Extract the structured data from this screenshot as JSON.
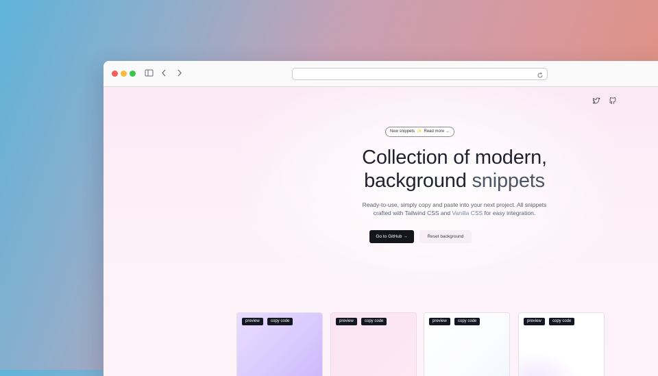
{
  "browser": {
    "url": "",
    "icons": [
      "sidebar-toggle-icon",
      "back-chevron-icon",
      "forward-chevron-icon",
      "reload-icon"
    ]
  },
  "header": {
    "social_icons": [
      "twitter-icon",
      "github-icon"
    ]
  },
  "hero": {
    "badge_left": "New snippets",
    "badge_sep": "✨",
    "badge_right": "Read more →",
    "title_line1": "Collection of modern,",
    "title_line2_a": "background",
    "title_line2_b": " snippets",
    "subtitle_a": "Ready-to-use, simply copy and paste into your next project. All snippets",
    "subtitle_b": "crafted with Tailwind CSS and ",
    "subtitle_link": "Vanilla CSS",
    "subtitle_c": " for easy integration.",
    "primary_button": "Go to GitHub →",
    "secondary_button": "Reset background"
  },
  "cards": [
    {
      "preview": "preview",
      "copy": "copy code"
    },
    {
      "preview": "preview",
      "copy": "copy code"
    },
    {
      "preview": "preview",
      "copy": "copy code"
    },
    {
      "preview": "preview",
      "copy": "copy code"
    }
  ]
}
